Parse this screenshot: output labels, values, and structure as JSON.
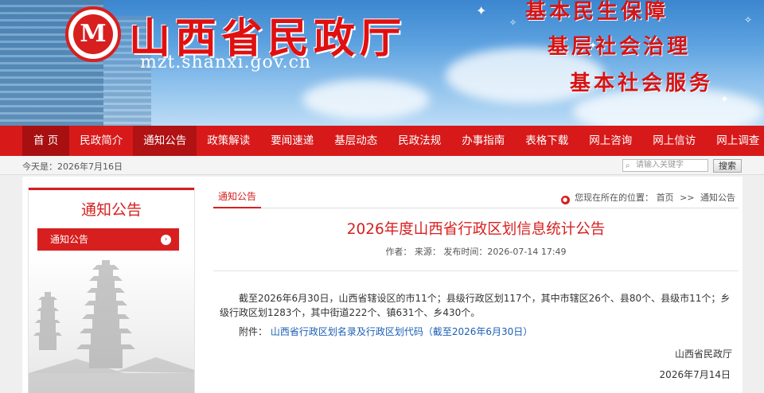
{
  "header": {
    "logo_char": "M",
    "site_name": "山西省民政厅",
    "domain": "mzt.shanxi.gov.cn",
    "slogans": [
      "基本民生保障",
      "基层社会治理",
      "基本社会服务"
    ]
  },
  "nav": {
    "items": [
      {
        "label": "首 页"
      },
      {
        "label": "民政简介"
      },
      {
        "label": "通知公告"
      },
      {
        "label": "政策解读"
      },
      {
        "label": "要闻速递"
      },
      {
        "label": "基层动态"
      },
      {
        "label": "民政法规"
      },
      {
        "label": "办事指南"
      },
      {
        "label": "表格下载"
      },
      {
        "label": "网上咨询"
      },
      {
        "label": "网上信访"
      },
      {
        "label": "网上调查"
      }
    ],
    "active_index": 2
  },
  "datebar": {
    "today": "今天是：2026年7月16日",
    "search_placeholder": "请输入关键字",
    "search_button": "搜索"
  },
  "sidebar": {
    "title": "通知公告",
    "items": [
      {
        "label": "通知公告"
      }
    ]
  },
  "main": {
    "category": "通知公告",
    "location_label": "您现在所在的位置：",
    "breadcrumb_home": "首页",
    "breadcrumb_sep": ">>",
    "breadcrumb_current": "通知公告",
    "title": "2026年度山西省行政区划信息统计公告",
    "meta": "作者：  来源：  发布时间：2026-07-14 17:49",
    "body": "截至2026年6月30日，山西省辖设区的市11个；县级行政区划117个，其中市辖区26个、县80个、县级市11个；乡级行政区划1283个，其中街道222个、镇631个、乡430个。",
    "attachment_label": "附件：",
    "attachment_link": "山西省行政区划名录及行政区划代码（截至2026年6月30日）",
    "signature": "山西省民政厅",
    "sign_date": "2026年7月14日"
  },
  "colors": {
    "brand_red": "#d71f1f",
    "nav_red": "#d7191a",
    "link_blue": "#1b5fb4"
  }
}
